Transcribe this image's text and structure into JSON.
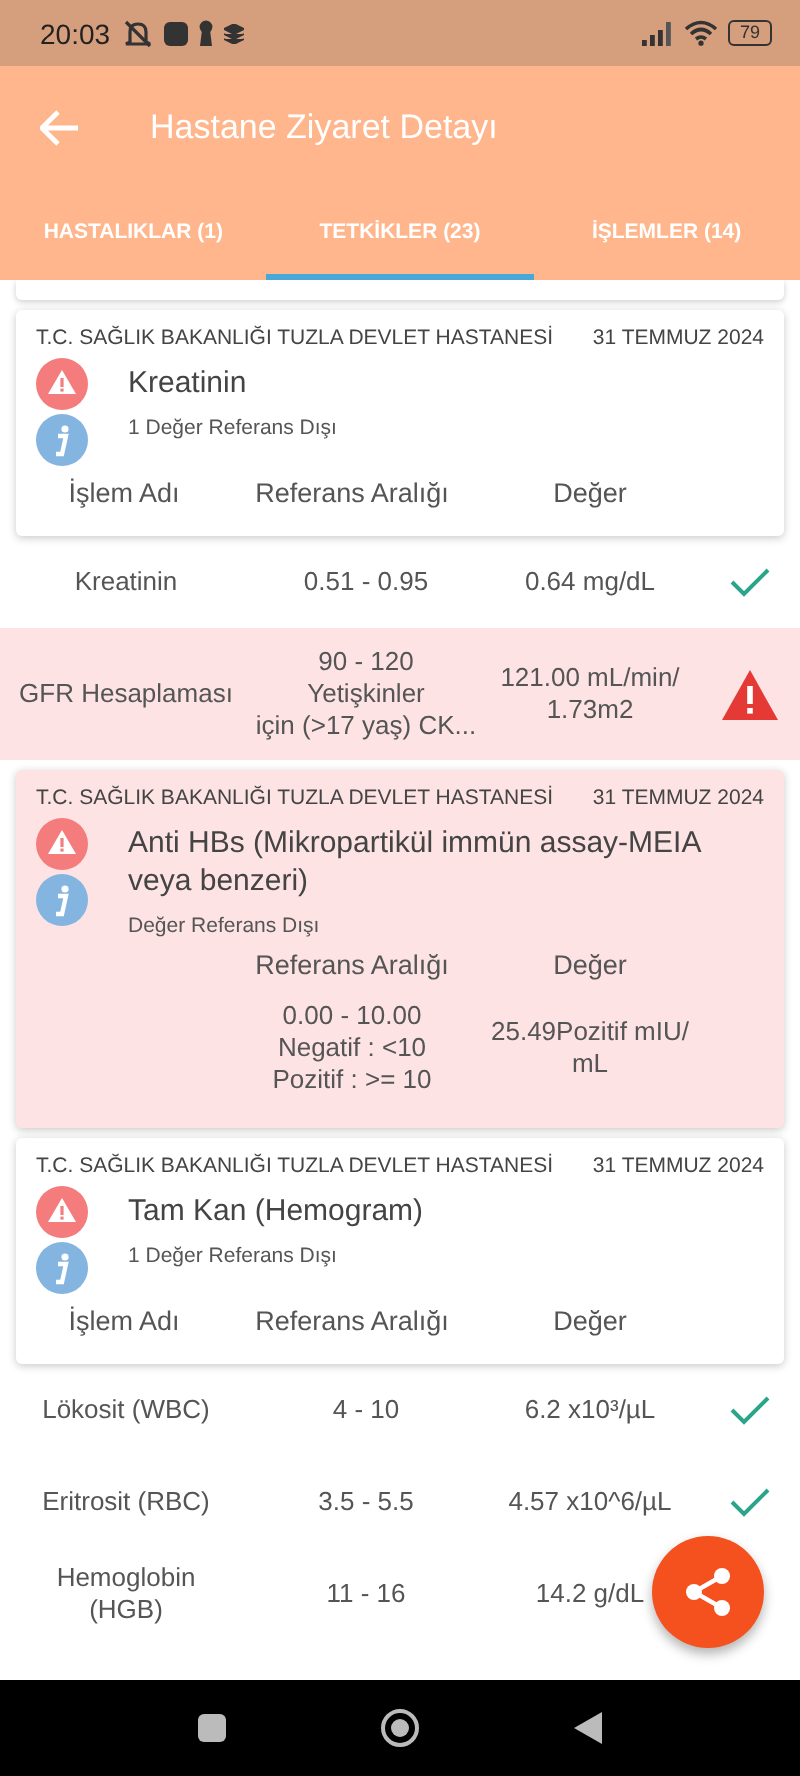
{
  "status_bar": {
    "time": "20:03",
    "battery": "79"
  },
  "app_bar": {
    "title": "Hastane Ziyaret Detayı"
  },
  "tabs": [
    {
      "label": "HASTALIKLAR (1)",
      "selected": false
    },
    {
      "label": "TETKİKLER (23)",
      "selected": true
    },
    {
      "label": "İŞLEMLER (14)",
      "selected": false
    }
  ],
  "groups": [
    {
      "kind": "table",
      "flagged": false,
      "hospital": "T.C. SAĞLIK BAKANLIĞI TUZLA DEVLET HASTANESİ",
      "date": "31 TEMMUZ 2024",
      "title": "Kreatinin",
      "subtitle": "1 Değer Referans Dışı",
      "columns": [
        "İşlem Adı",
        "Referans Aralığı",
        "Değer"
      ],
      "rows": [
        {
          "name": "Kreatinin",
          "range": "0.51 - 0.95",
          "value": "0.64 mg/dL",
          "flagged": false
        },
        {
          "name": "GFR Hesaplaması",
          "range": "90 - 120\nYetişkinler\niçin (>17 yaş) CK...",
          "value": "121.00 mL/min/\n1.73m2",
          "flagged": true
        }
      ]
    },
    {
      "kind": "inline",
      "flagged": true,
      "hospital": "T.C. SAĞLIK BAKANLIĞI TUZLA DEVLET HASTANESİ",
      "date": "31 TEMMUZ 2024",
      "title": "Anti HBs (Mikropartikül immün assay-MEIA veya benzeri)",
      "subtitle": "Değer Referans Dışı",
      "columns": [
        "Referans Aralığı",
        "Değer"
      ],
      "rows": [
        {
          "range": "0.00 - 10.00\nNegatif : <10\nPozitif : >= 10",
          "value": "25.49Pozitif mIU/\nmL"
        }
      ]
    },
    {
      "kind": "table",
      "flagged": false,
      "hospital": "T.C. SAĞLIK BAKANLIĞI TUZLA DEVLET HASTANESİ",
      "date": "31 TEMMUZ 2024",
      "title": "Tam Kan (Hemogram)",
      "subtitle": "1 Değer Referans Dışı",
      "columns": [
        "İşlem Adı",
        "Referans Aralığı",
        "Değer"
      ],
      "rows": [
        {
          "name": "Lökosit (WBC)",
          "range": "4 - 10",
          "value": "6.2 x10³/µL",
          "flagged": false
        },
        {
          "name": "Eritrosit (RBC)",
          "range": "3.5 - 5.5",
          "value": "4.57 x10^6/µL",
          "flagged": false
        },
        {
          "name": "Hemoglobin\n(HGB)",
          "range": "11 - 16",
          "value": "14.2 g/dL"
        }
      ]
    }
  ]
}
